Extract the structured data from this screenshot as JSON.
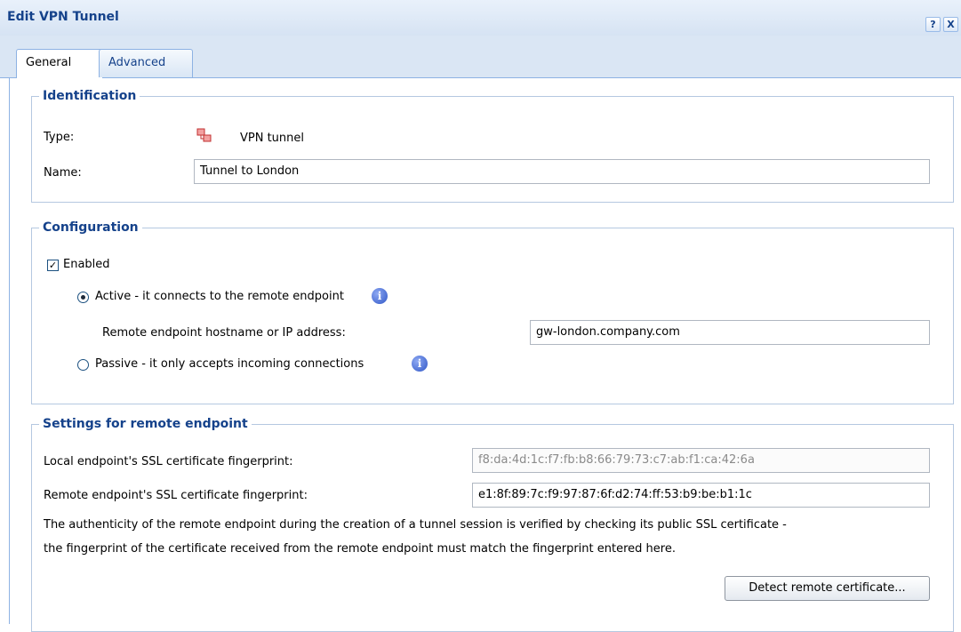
{
  "window": {
    "title": "Edit VPN Tunnel",
    "help_label": "?",
    "close_label": "X"
  },
  "tabs": [
    {
      "label": "General",
      "active": true
    },
    {
      "label": "Advanced",
      "active": false
    }
  ],
  "identification": {
    "legend": "Identification",
    "type_label": "Type:",
    "type_value": "VPN tunnel",
    "type_icon": "vpn-tunnel-icon",
    "name_label": "Name:",
    "name_value": "Tunnel to London"
  },
  "configuration": {
    "legend": "Configuration",
    "enabled_label": "Enabled",
    "enabled_checked": true,
    "active_label": "Active - it connects to the remote endpoint",
    "active_selected": true,
    "remote_host_label": "Remote endpoint hostname or IP address:",
    "remote_host_value": "gw-london.company.com",
    "passive_label": "Passive - it only accepts incoming connections",
    "passive_selected": false,
    "info_glyph": "i",
    "check_glyph": "✓"
  },
  "remote_settings": {
    "legend": "Settings for remote endpoint",
    "local_fp_label": "Local endpoint's SSL certificate fingerprint:",
    "local_fp_value": "f8:da:4d:1c:f7:fb:b8:66:79:73:c7:ab:f1:ca:42:6a",
    "remote_fp_label": "Remote endpoint's SSL certificate fingerprint:",
    "remote_fp_value": "e1:8f:89:7c:f9:97:87:6f:d2:74:ff:53:b9:be:b1:1c",
    "description_line1": "The authenticity of the remote endpoint during the creation of a tunnel session is verified by checking its public SSL certificate -",
    "description_line2": "the fingerprint of the certificate received from the remote endpoint must match the fingerprint entered here.",
    "detect_button": "Detect remote certificate..."
  },
  "colors": {
    "title_text": "#15428b",
    "info_icon": "#2f56c6",
    "border": "#b5c8e0"
  }
}
